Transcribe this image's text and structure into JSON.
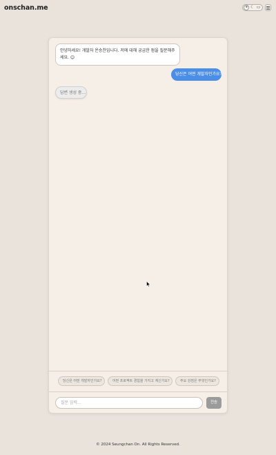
{
  "header": {
    "logo": "onschan.me",
    "theme_options": [
      {
        "icon": "sun-icon",
        "glyph": "☀",
        "active": true
      },
      {
        "icon": "moon-icon",
        "glyph": "☾",
        "active": false
      },
      {
        "icon": "monitor-icon",
        "glyph": "▭",
        "active": false
      }
    ],
    "menu_icon": "hamburger-icon"
  },
  "chat": {
    "messages": {
      "bot_intro": "안녕하세요! 개발자 온승찬입니다. 저에 대해 궁금한 점을 질문해주세요. 😊",
      "user_question": "당신은 어떤 개발자인가요?",
      "loading": "답변 생성 중..."
    },
    "suggestions": [
      "당신은 어떤 개발자인가요?",
      "어떤 프로젝트 경험을 가지고 계신가요?",
      "주요 강점은 무엇인가요?"
    ],
    "input": {
      "placeholder": "질문 입력...",
      "value": ""
    },
    "send_label": "전송"
  },
  "colors": {
    "page_bg": "#e9e3dc",
    "card_bg": "#f6efe7",
    "user_bubble": "#4b8ee8",
    "send_button": "#9b9b9b"
  },
  "footer": {
    "copyright": "© 2024 Seungchan On. All Rights Reserved."
  }
}
